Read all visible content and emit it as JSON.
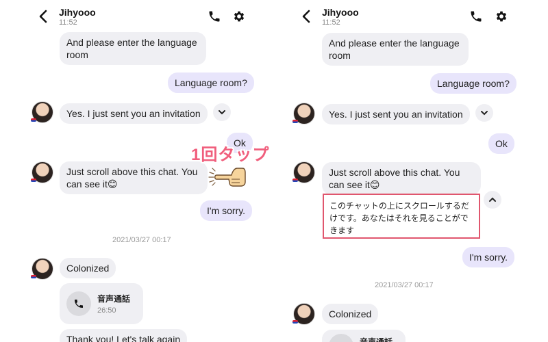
{
  "header": {
    "contact_name": "Jihyooo",
    "time": "11:52"
  },
  "messages": {
    "language_request": "And please enter the language room",
    "language_room": "Language room?",
    "invitation": "Yes. I just sent you an invitation",
    "ok": "Ok",
    "scroll_hint": "Just scroll above this chat. You can see it😊",
    "sorry": "I'm sorry.",
    "date_divider": "2021/03/27 00:17",
    "colonized": "Colonized",
    "thank_you": "Thank you! Let's talk again"
  },
  "call": {
    "label": "音声通話",
    "duration": "26:50"
  },
  "annotation": {
    "tap_label": "1回タップ"
  },
  "translation": {
    "text": "このチャットの上にスクロールするだけです。あなたはそれを見ることができます"
  },
  "icons": [
    "back-arrow-icon",
    "phone-icon",
    "gear-icon",
    "chevron-down-icon",
    "chevron-up-icon",
    "tap-hand-icon"
  ],
  "colors": {
    "incoming_bubble": "#efeff3",
    "outgoing_bubble": "#e8e5fb",
    "annotation": "#f05e7c",
    "highlight_border": "#e0566e"
  }
}
